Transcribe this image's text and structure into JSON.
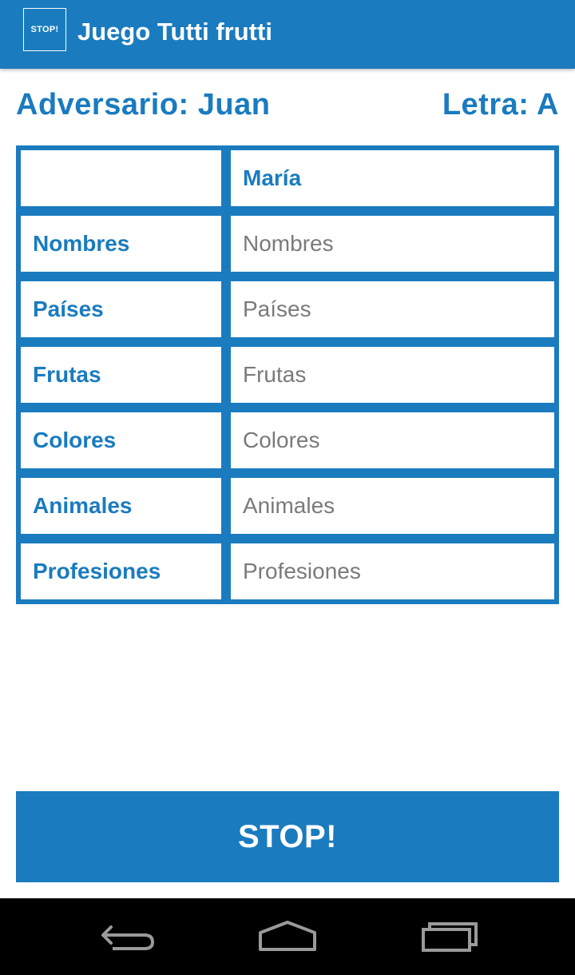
{
  "appbar": {
    "icon_text": "STOP!",
    "title": "Juego Tutti frutti"
  },
  "info": {
    "opponent": "Adversario: Juan",
    "letter": "Letra: A"
  },
  "table": {
    "header_player": "María",
    "rows": [
      {
        "category": "Nombres",
        "placeholder": "Nombres"
      },
      {
        "category": "Países",
        "placeholder": "Países"
      },
      {
        "category": "Frutas",
        "placeholder": "Frutas"
      },
      {
        "category": "Colores",
        "placeholder": "Colores"
      },
      {
        "category": "Animales",
        "placeholder": "Animales"
      },
      {
        "category": "Profesiones",
        "placeholder": "Profesiones"
      }
    ]
  },
  "stop_button": {
    "label": "STOP!"
  },
  "navbar": {
    "icons": [
      "back-icon",
      "home-icon",
      "recents-icon"
    ]
  },
  "colors": {
    "primary": "#1a7bbf",
    "placeholder_text": "#7a7a7a",
    "navbar": "#000000"
  }
}
